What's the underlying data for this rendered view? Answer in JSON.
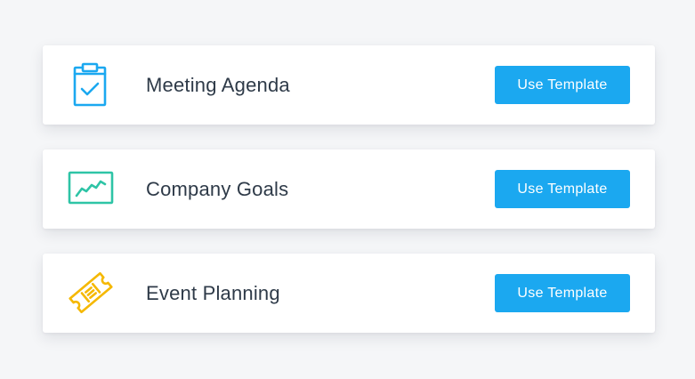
{
  "templates": [
    {
      "name": "Meeting Agenda",
      "icon": "clipboard-check-icon",
      "icon_color": "#1ba8f0",
      "button_label": "Use Template"
    },
    {
      "name": "Company Goals",
      "icon": "line-chart-icon",
      "icon_color": "#2ec4a6",
      "button_label": "Use Template"
    },
    {
      "name": "Event Planning",
      "icon": "ticket-icon",
      "icon_color": "#f5b800",
      "button_label": "Use Template"
    }
  ],
  "colors": {
    "background": "#f5f6f8",
    "card": "#ffffff",
    "button": "#1ba8f0",
    "text": "#2e3a48"
  }
}
